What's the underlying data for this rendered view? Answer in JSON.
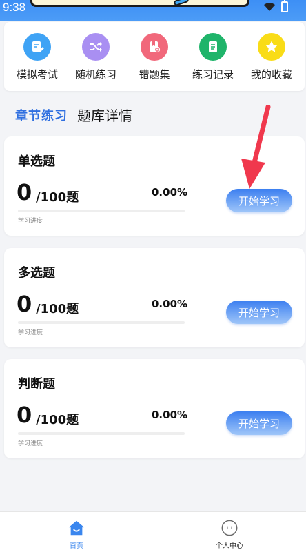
{
  "status_bar": {
    "time": "9:38"
  },
  "quick_menu": [
    {
      "label": "模拟考试",
      "icon": "pencil-doc-icon",
      "color": "#3fa3f5"
    },
    {
      "label": "随机练习",
      "icon": "shuffle-icon",
      "color": "#a98ff2"
    },
    {
      "label": "错题集",
      "icon": "error-book-icon",
      "color": "#f1687b"
    },
    {
      "label": "练习记录",
      "icon": "record-icon",
      "color": "#1fb46a"
    },
    {
      "label": "我的收藏",
      "icon": "star-icon",
      "color": "#f9dc17"
    }
  ],
  "tabs": {
    "active": "章节练习",
    "other": "题库详情"
  },
  "question_cards": [
    {
      "title": "单选题",
      "done": "0",
      "total": "/100题",
      "percent": "0.00%",
      "progress_label": "学习进度",
      "button": "开始学习",
      "progress": 0
    },
    {
      "title": "多选题",
      "done": "0",
      "total": "/100题",
      "percent": "0.00%",
      "progress_label": "学习进度",
      "button": "开始学习",
      "progress": 0
    },
    {
      "title": "判断题",
      "done": "0",
      "total": "/100题",
      "percent": "0.00%",
      "progress_label": "学习进度",
      "button": "开始学习",
      "progress": 0
    }
  ],
  "bottom_nav": [
    {
      "label": "首页",
      "icon": "home-icon",
      "active": true
    },
    {
      "label": "个人中心",
      "icon": "profile-icon",
      "active": false
    }
  ],
  "colors": {
    "accent": "#3a86ee",
    "annotation": "#f0384d"
  }
}
